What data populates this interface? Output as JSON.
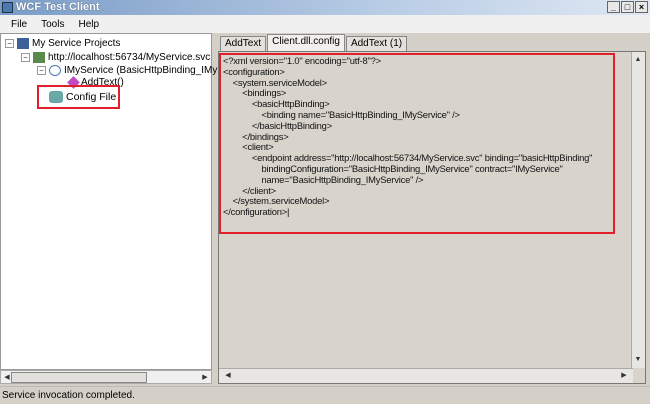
{
  "window": {
    "title": "WCF Test Client",
    "controls": [
      "_",
      "□",
      "×"
    ]
  },
  "menu": [
    "File",
    "Tools",
    "Help"
  ],
  "tree": {
    "root": "My Service Projects",
    "endpoint": "http://localhost:56734/MyService.svc",
    "contract": "IMyService (BasicHttpBinding_IMyService)",
    "operation": "AddText()",
    "config": "Config File"
  },
  "tabs": [
    "AddText",
    "Client.dll.config",
    "AddText (1)"
  ],
  "active_tab": 1,
  "config_text": "<?xml version=\"1.0\" encoding=\"utf-8\"?>\n<configuration>\n    <system.serviceModel>\n        <bindings>\n            <basicHttpBinding>\n                <binding name=\"BasicHttpBinding_IMyService\" />\n            </basicHttpBinding>\n        </bindings>\n        <client>\n            <endpoint address=\"http://localhost:56734/MyService.svc\" binding=\"basicHttpBinding\"\n                bindingConfiguration=\"BasicHttpBinding_IMyService\" contract=\"IMyService\"\n                name=\"BasicHttpBinding_IMyService\" />\n        </client>\n    </system.serviceModel>\n</configuration>|",
  "status": "Service invocation completed.",
  "colors": {
    "highlight": "#e0202a",
    "editor_bg": "#d8d4cc"
  }
}
